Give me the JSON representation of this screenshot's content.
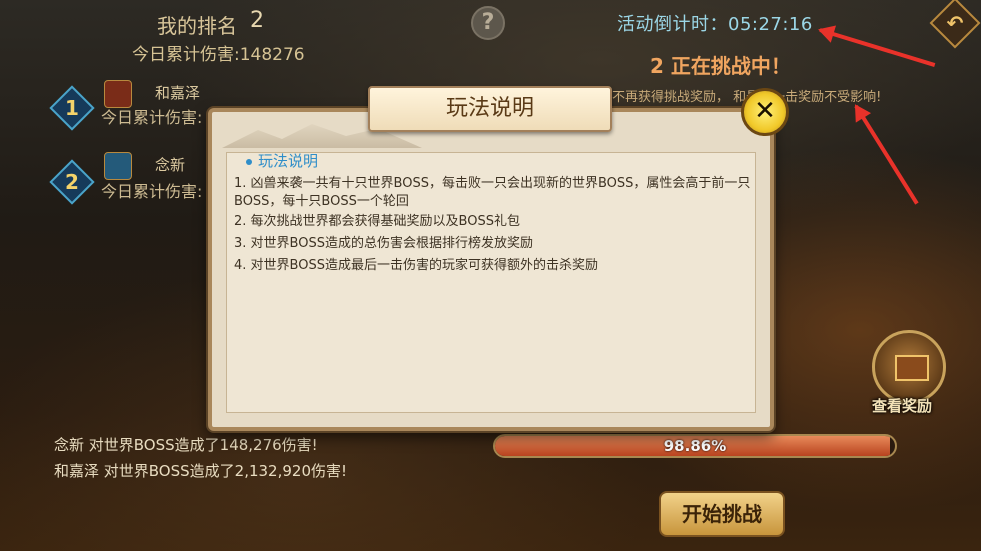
{
  "header": {
    "rank_label": "我的排名",
    "rank_value": "2",
    "today_damage": "今日累计伤害:148276",
    "help_icon_text": "?",
    "countdown": "活动倒计时：05:27:16",
    "back_icon_text": "↶"
  },
  "status": {
    "challenging": "2  正在挑战中！",
    "notice": "不再获得挑战奖励，    和最后一击奖励不受影响!"
  },
  "ranking": [
    {
      "rank": "1",
      "name": "和嘉泽",
      "damage": "今日累计伤害:"
    },
    {
      "rank": "2",
      "name": "念新",
      "damage": "今日累计伤害:"
    }
  ],
  "battle_log": [
    "念新  对世界BOSS造成了148,276伤害!",
    "和嘉泽  对世界BOSS造成了2,132,920伤害!"
  ],
  "rewards": {
    "label": "查看奖励"
  },
  "boss_hp": {
    "percent_text": "98.86%",
    "fraction": 0.9886
  },
  "start_button": {
    "label": "开始挑战"
  },
  "dialog": {
    "title": "玩法说明",
    "close_icon_text": "✕",
    "section_title": "玩法说明",
    "rules": [
      "1.  凶兽来袭一共有十只世界BOSS，每击败一只会出现新的世界BOSS，属性会高于前一只BOSS，每十只BOSS一个轮回",
      "2.  每次挑战世界都会获得基础奖励以及BOSS礼包",
      "3.  对世界BOSS造成的总伤害会根据排行榜发放奖励",
      "4.  对世界BOSS造成最后一击伤害的玩家可获得额外的击杀奖励"
    ]
  },
  "colors": {
    "arrow": "#e9322a",
    "countdown": "#9bd6e6",
    "section": "#2f8ec9"
  }
}
